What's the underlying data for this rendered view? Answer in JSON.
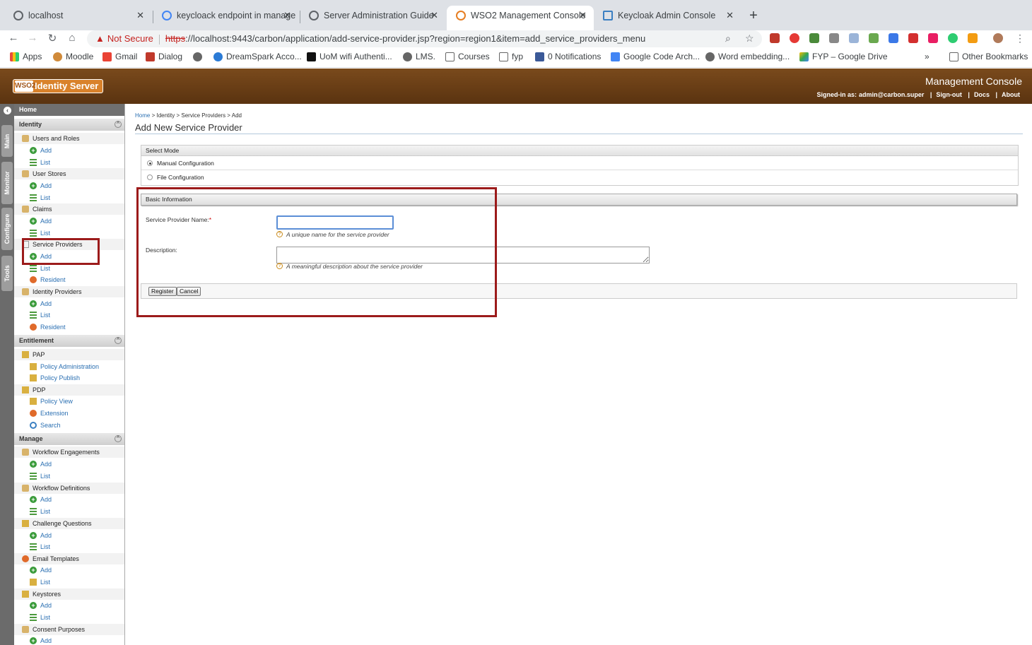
{
  "browser": {
    "tabs": [
      {
        "title": "localhost"
      },
      {
        "title": "keycloack endpoint in manage"
      },
      {
        "title": "Server Administration Guide"
      },
      {
        "title": "WSO2 Management Console"
      },
      {
        "title": "Keycloak Admin Console"
      }
    ],
    "security_label": "Not Secure",
    "url_scheme": "https",
    "url_rest": "://localhost:9443/carbon/application/add-service-provider.jsp?region=region1&item=add_service_providers_menu",
    "bookmarks": [
      "Apps",
      "Moodle",
      "Gmail",
      "Dialog",
      "DreamSpark Acco...",
      "UoM wifi Authenti...",
      "LMS.",
      "Courses",
      "fyp",
      "0 Notifications",
      "Google Code Arch...",
      "Word embedding...",
      "FYP – Google Drive"
    ],
    "other_bookmarks": "Other Bookmarks",
    "overflow": "»"
  },
  "header": {
    "logo_wso": "WSO2",
    "logo_product": "Identity Server",
    "console_title": "Management Console",
    "signed_in_label": "Signed-in as:",
    "signed_in_user": "admin@carbon.super",
    "signout": "Sign-out",
    "docs": "Docs",
    "about": "About"
  },
  "vtabs": [
    "Main",
    "Monitor",
    "Configure",
    "Tools"
  ],
  "sidebar": {
    "home": "Home",
    "sections": {
      "identity": "Identity",
      "entitlement": "Entitlement",
      "manage": "Manage"
    },
    "items": {
      "users_roles": "Users and Roles",
      "user_stores": "User Stores",
      "claims": "Claims",
      "service_providers": "Service Providers",
      "identity_providers": "Identity Providers",
      "pap": "PAP",
      "policy_admin": "Policy Administration",
      "policy_publish": "Policy Publish",
      "pdp": "PDP",
      "policy_view": "Policy View",
      "extension": "Extension",
      "search": "Search",
      "workflow_engagements": "Workflow Engagements",
      "workflow_definitions": "Workflow Definitions",
      "challenge_questions": "Challenge Questions",
      "email_templates": "Email Templates",
      "keystores": "Keystores",
      "consent_purposes": "Consent Purposes",
      "add": "Add",
      "list": "List",
      "resident": "Resident"
    }
  },
  "content": {
    "breadcrumb": [
      "Home",
      "Identity",
      "Service Providers",
      "Add"
    ],
    "breadcrumb_sep": " > ",
    "page_title": "Add New Service Provider",
    "select_mode": {
      "title": "Select Mode",
      "manual": "Manual Configuration",
      "file": "File Configuration",
      "selected": "manual"
    },
    "basic_info": {
      "title": "Basic Information",
      "sp_name_label": "Service Provider Name:",
      "required_mark": "*",
      "sp_name_value": "",
      "sp_name_hint": "A unique name for the service provider",
      "description_label": "Description:",
      "description_value": "",
      "description_hint": "A meaningful description about the service provider"
    },
    "buttons": {
      "register": "Register",
      "cancel": "Cancel"
    }
  },
  "colors": {
    "header_brown": "#6a3d16",
    "highlight_red": "#9c1b1b",
    "link_blue": "#2a6fb2"
  }
}
